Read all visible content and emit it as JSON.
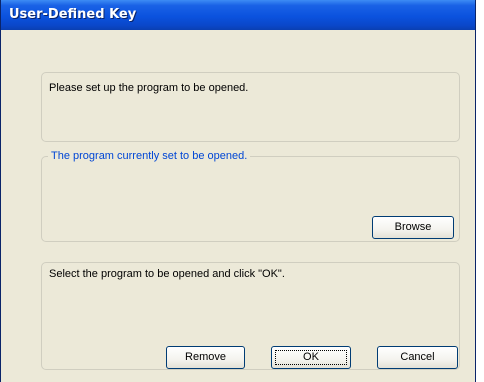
{
  "window": {
    "title": "User-Defined Key"
  },
  "info_group": {
    "text": "Please set up the program to be opened."
  },
  "current_program_group": {
    "legend": "The program currently set to be opened.",
    "value": "",
    "browse_label": "Browse"
  },
  "select_group": {
    "text": "Select the program to be opened and click \"OK\"."
  },
  "buttons": {
    "remove_label": "Remove",
    "ok_label": "OK",
    "cancel_label": "Cancel"
  },
  "colors": {
    "titlebar": "#0b52de",
    "dialog_background": "#ece9d8",
    "legend_text": "#0046d5"
  }
}
